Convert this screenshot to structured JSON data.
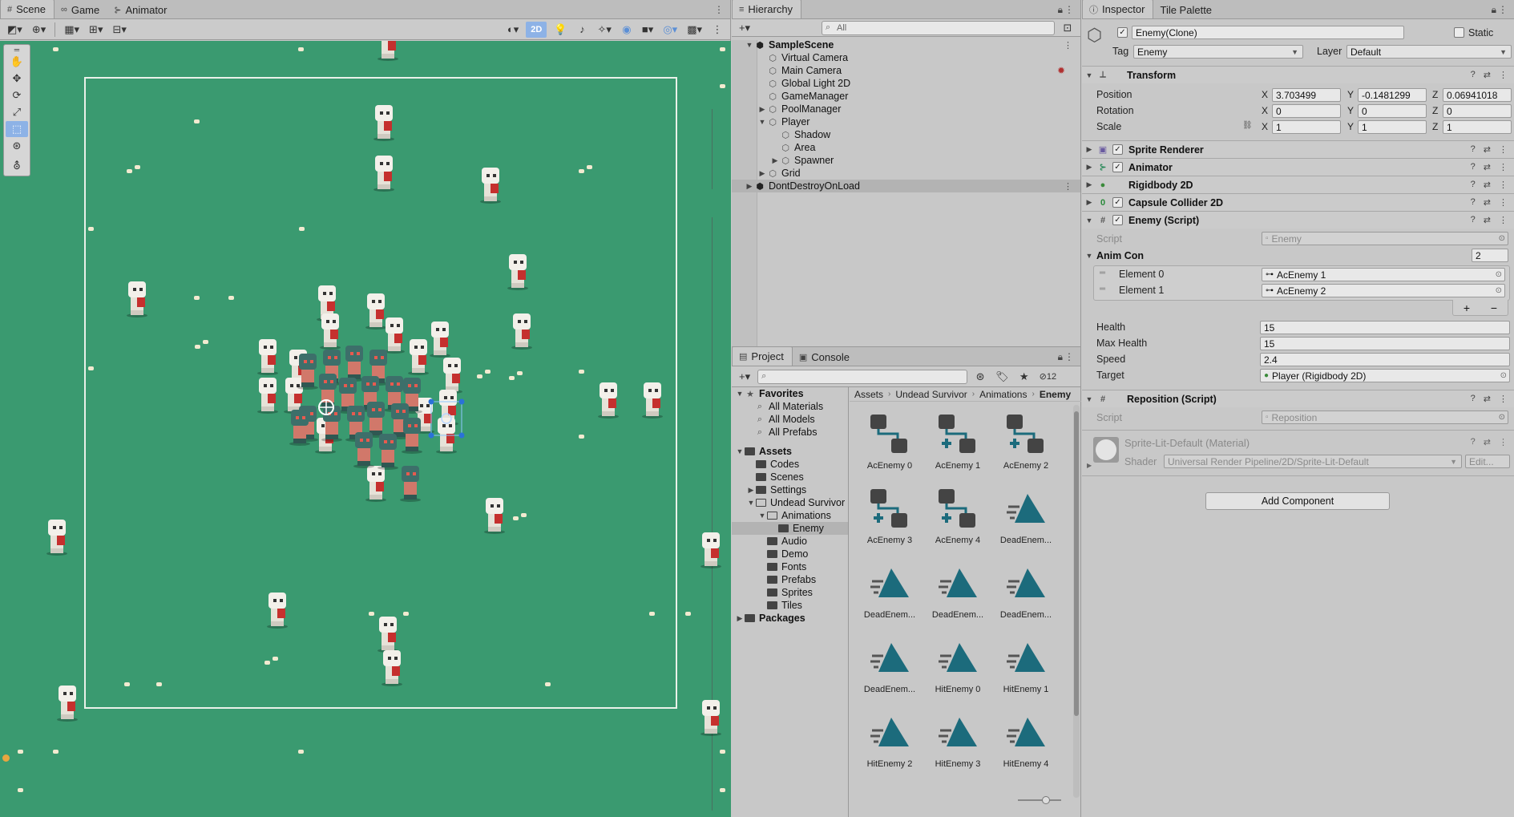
{
  "scene_panel": {
    "tabs": [
      {
        "label": "Scene",
        "icon": "#"
      },
      {
        "label": "Game",
        "icon": "∞"
      },
      {
        "label": "Animator",
        "icon": "⊱"
      }
    ],
    "toolbar": {
      "btn_2d": "2D"
    }
  },
  "hierarchy": {
    "tab": "Hierarchy",
    "search_placeholder": "All",
    "items": [
      {
        "label": "SampleScene",
        "depth": 0,
        "arrow": "▼",
        "bold": true,
        "icon": "unity-icon"
      },
      {
        "label": "Virtual Camera",
        "depth": 1,
        "arrow": "",
        "icon": "cube-icon"
      },
      {
        "label": "Main Camera",
        "depth": 1,
        "arrow": "",
        "icon": "cube-icon"
      },
      {
        "label": "Global Light 2D",
        "depth": 1,
        "arrow": "",
        "icon": "cube-icon"
      },
      {
        "label": "GameManager",
        "depth": 1,
        "arrow": "",
        "icon": "cube-icon"
      },
      {
        "label": "PoolManager",
        "depth": 1,
        "arrow": "▶",
        "icon": "cube-icon"
      },
      {
        "label": "Player",
        "depth": 1,
        "arrow": "▼",
        "icon": "cube-icon"
      },
      {
        "label": "Shadow",
        "depth": 2,
        "arrow": "",
        "icon": "cube-icon"
      },
      {
        "label": "Area",
        "depth": 2,
        "arrow": "",
        "icon": "cube-icon"
      },
      {
        "label": "Spawner",
        "depth": 2,
        "arrow": "▶",
        "icon": "cube-icon"
      },
      {
        "label": "Grid",
        "depth": 1,
        "arrow": "▶",
        "icon": "cube-icon"
      },
      {
        "label": "DontDestroyOnLoad",
        "depth": 0,
        "arrow": "▶",
        "icon": "unity-icon",
        "selected": true
      }
    ]
  },
  "project": {
    "tabs": [
      {
        "label": "Project",
        "icon": "▤"
      },
      {
        "label": "Console",
        "icon": "▣"
      }
    ],
    "hidden_count": "12",
    "favorites_label": "Favorites",
    "favorites": [
      "All Materials",
      "All Models",
      "All Prefabs"
    ],
    "assets_label": "Assets",
    "folders": [
      {
        "label": "Codes",
        "depth": 1,
        "arrow": ""
      },
      {
        "label": "Scenes",
        "depth": 1,
        "arrow": ""
      },
      {
        "label": "Settings",
        "depth": 1,
        "arrow": "▶"
      },
      {
        "label": "Undead Survivor",
        "depth": 1,
        "arrow": "▼"
      },
      {
        "label": "Animations",
        "depth": 2,
        "arrow": "▼"
      },
      {
        "label": "Enemy",
        "depth": 3,
        "arrow": "",
        "selected": true
      },
      {
        "label": "Audio",
        "depth": 2,
        "arrow": ""
      },
      {
        "label": "Demo",
        "depth": 2,
        "arrow": ""
      },
      {
        "label": "Fonts",
        "depth": 2,
        "arrow": ""
      },
      {
        "label": "Prefabs",
        "depth": 2,
        "arrow": ""
      },
      {
        "label": "Sprites",
        "depth": 2,
        "arrow": ""
      },
      {
        "label": "Tiles",
        "depth": 2,
        "arrow": ""
      }
    ],
    "packages_label": "Packages",
    "breadcrumb": [
      "Assets",
      "Undead Survivor",
      "Animations",
      "Enemy"
    ],
    "assets": [
      {
        "label": "AcEnemy 0",
        "kind": "controller-plain"
      },
      {
        "label": "AcEnemy 1",
        "kind": "controller-plus"
      },
      {
        "label": "AcEnemy 2",
        "kind": "controller-plus"
      },
      {
        "label": "AcEnemy 3",
        "kind": "controller-plus"
      },
      {
        "label": "AcEnemy 4",
        "kind": "controller-plus"
      },
      {
        "label": "DeadEnem...",
        "kind": "clip"
      },
      {
        "label": "DeadEnem...",
        "kind": "clip"
      },
      {
        "label": "DeadEnem...",
        "kind": "clip"
      },
      {
        "label": "DeadEnem...",
        "kind": "clip"
      },
      {
        "label": "DeadEnem...",
        "kind": "clip"
      },
      {
        "label": "HitEnemy 0",
        "kind": "clip"
      },
      {
        "label": "HitEnemy 1",
        "kind": "clip"
      },
      {
        "label": "HitEnemy 2",
        "kind": "clip"
      },
      {
        "label": "HitEnemy 3",
        "kind": "clip"
      },
      {
        "label": "HitEnemy 4",
        "kind": "clip"
      }
    ]
  },
  "inspector": {
    "tabs": [
      {
        "label": "Inspector",
        "icon": "ⓘ"
      },
      {
        "label": "Tile Palette",
        "icon": ""
      }
    ],
    "object_name": "Enemy(Clone)",
    "static_label": "Static",
    "tag_label": "Tag",
    "tag_value": "Enemy",
    "layer_label": "Layer",
    "layer_value": "Default",
    "transform": {
      "title": "Transform",
      "position_label": "Position",
      "rotation_label": "Rotation",
      "scale_label": "Scale",
      "position": {
        "x": "3.703499",
        "y": "-0.1481299",
        "z": "0.06941018"
      },
      "rotation": {
        "x": "0",
        "y": "0",
        "z": "0"
      },
      "scale": {
        "x": "1",
        "y": "1",
        "z": "1"
      }
    },
    "components": [
      "Sprite Renderer",
      "Animator",
      "Rigidbody 2D",
      "Capsule Collider 2D"
    ],
    "enemy_script": {
      "title": "Enemy (Script)",
      "script_label": "Script",
      "script_value": "Enemy",
      "anim_con_label": "Anim Con",
      "anim_con_count": "2",
      "elements": [
        {
          "label": "Element 0",
          "value": "AcEnemy 1"
        },
        {
          "label": "Element 1",
          "value": "AcEnemy 2"
        }
      ],
      "health_label": "Health",
      "health": "15",
      "max_health_label": "Max Health",
      "max_health": "15",
      "speed_label": "Speed",
      "speed": "2.4",
      "target_label": "Target",
      "target": "Player (Rigidbody 2D)"
    },
    "reposition_script": {
      "title": "Reposition (Script)",
      "script_label": "Script",
      "script_value": "Reposition"
    },
    "material": {
      "name": "Sprite-Lit-Default (Material)",
      "shader_label": "Shader",
      "shader_value": "Universal Render Pipeline/2D/Sprite-Lit-Default",
      "edit_label": "Edit..."
    },
    "add_component_label": "Add Component"
  },
  "colors": {
    "scene_bg": "#3a9a70",
    "accent_blue": "#8db2e6",
    "clip_teal": "#1c6b7c"
  }
}
